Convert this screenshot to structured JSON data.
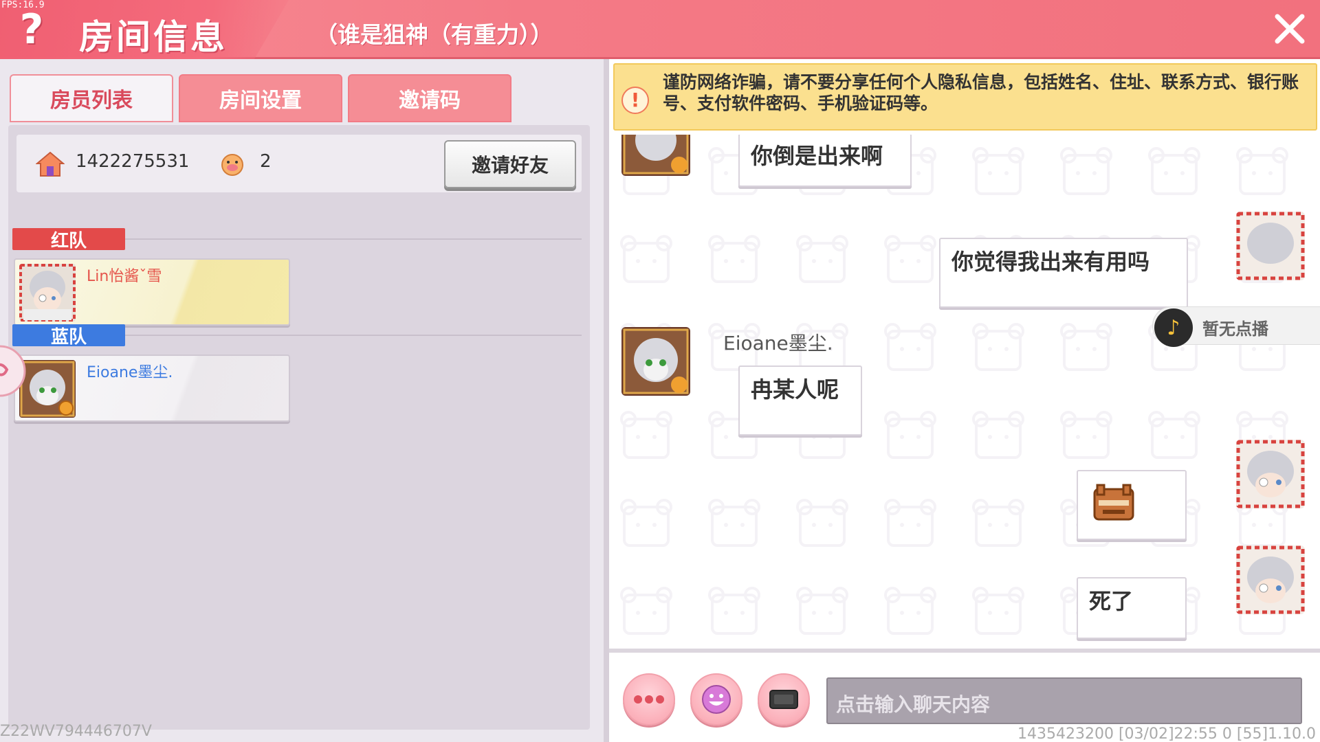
{
  "header": {
    "fps": "FPS:16.9",
    "help": "?",
    "title": "房间信息",
    "subtitle": "（谁是狙神（有重力））",
    "close": "✕"
  },
  "tabs": [
    {
      "label": "房员列表",
      "active": true
    },
    {
      "label": "房间设置",
      "active": false
    },
    {
      "label": "邀请码",
      "active": false
    }
  ],
  "room": {
    "id": "1422275531",
    "player_count": "2",
    "invite_button": "邀请好友"
  },
  "teams": {
    "red": {
      "label": "红队",
      "color": "#e34a4a",
      "players": [
        {
          "name": "Lin怡酱ˇ雪"
        }
      ]
    },
    "blue": {
      "label": "蓝队",
      "color": "#3d7be0",
      "players": [
        {
          "name": "Eioane墨尘."
        }
      ]
    }
  },
  "version_id": "Z22WV794446707V",
  "warning": {
    "icon": "!",
    "text": "谨防网络诈骗，请不要分享任何个人隐私信息，包括姓名、住址、联系方式、银行账号、支付软件密码、手机验证码等。"
  },
  "chat": {
    "messages": [
      {
        "side": "left",
        "sender": "",
        "text": "你倒是出来啊"
      },
      {
        "side": "right",
        "sender": "",
        "text": "你觉得我出来有用吗"
      },
      {
        "side": "left",
        "sender": "Eioane墨尘.",
        "text": "冉某人呢"
      },
      {
        "side": "right",
        "sender": "",
        "text": "",
        "emoji": "face-emoji"
      },
      {
        "side": "right",
        "sender": "",
        "text": "死了"
      }
    ],
    "music": {
      "icon": "♪",
      "text": "暂无点播"
    }
  },
  "input": {
    "placeholder": "点击输入聊天内容",
    "buttons": [
      "more-icon",
      "emoji-icon",
      "keyboard-icon"
    ]
  },
  "footer": {
    "info": "1435423200   [03/02]22:55 0   [55]1.10.0"
  }
}
